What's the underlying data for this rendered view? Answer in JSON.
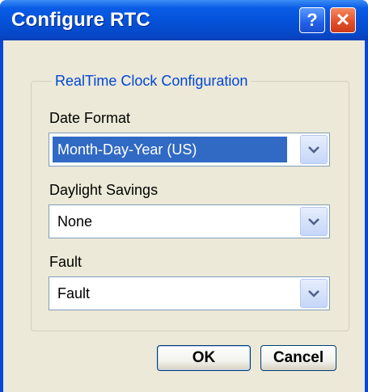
{
  "window": {
    "title": "Configure RTC",
    "help_glyph": "?",
    "close_glyph": "✕"
  },
  "group": {
    "label": "RealTime Clock Configuration"
  },
  "date_format": {
    "label": "Date Format",
    "value": "Month-Day-Year (US)"
  },
  "daylight_savings": {
    "label": "Daylight Savings",
    "value": "None"
  },
  "fault": {
    "label": "Fault",
    "value": "Fault"
  },
  "buttons": {
    "ok": "OK",
    "cancel": "Cancel"
  },
  "icons": {
    "help": "help-icon",
    "close": "close-icon",
    "dropdown": "chevron-down-icon"
  },
  "colors": {
    "titlebar": "#0551d8",
    "group_label": "#0046d5",
    "selection": "#316ac5",
    "client_bg": "#ece9d8"
  }
}
